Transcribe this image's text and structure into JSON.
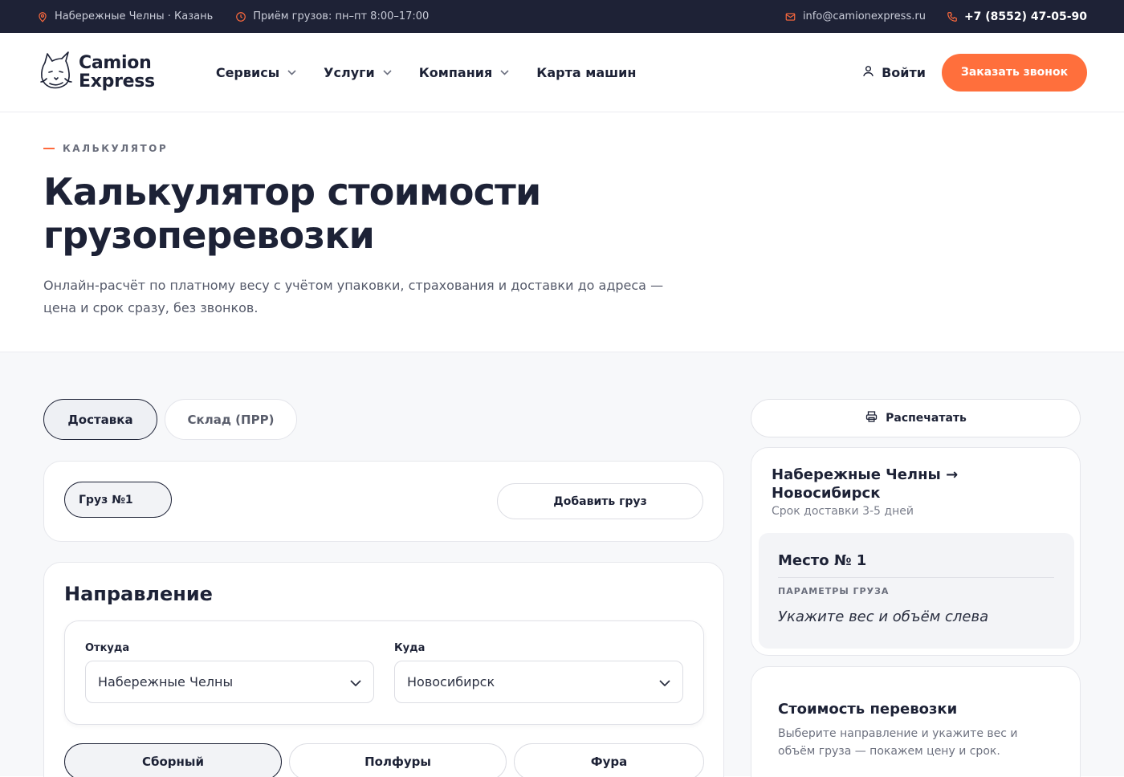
{
  "topbar": {
    "location": "Набережные Челны · Казань",
    "hours": "Приём грузов: пн–пт 8:00–17:00",
    "email": "info@camionexpress.ru",
    "phone": "+7 (8552) 47-05-90"
  },
  "header": {
    "logo_line1": "Camion",
    "logo_line2": "Express",
    "nav": [
      "Сервисы",
      "Услуги",
      "Компания",
      "Карта машин"
    ],
    "login": "Войти",
    "callback": "Заказать звонок"
  },
  "hero": {
    "eyebrow": "КАЛЬКУЛЯТОР",
    "title_line1": "Калькулятор стоимости",
    "title_line2": "грузоперевозки",
    "subtitle_line1": "Онлайн-расчёт по платному весу с учётом упаковки, страхования и доставки до адреса —",
    "subtitle_line2": "цена и срок сразу, без звонков."
  },
  "calculator": {
    "tabs": [
      "Доставка",
      "Склад (ПРР)"
    ],
    "active_tab": "Доставка",
    "cargo_pill": "Груз №1",
    "add_cargo": "Добавить груз",
    "direction": {
      "title": "Направление",
      "from_label": "Откуда",
      "from_value": "Набережные Челны",
      "to_label": "Куда",
      "to_value": "Новосибирск"
    },
    "transport_types": [
      "Сборный",
      "Полфуры",
      "Фура"
    ],
    "active_type": "Сборный"
  },
  "sidebar": {
    "print": "Распечатать",
    "route_title": "Набережные Челны → Новосибирск",
    "route_term": "Срок доставки 3-5 дней",
    "place_title": "Место № 1",
    "place_label": "ПАРАМЕТРЫ ГРУЗА",
    "place_hint": "Укажите вес и объём слева",
    "cost_title": "Стоимость перевозки",
    "cost_desc": "Выберите направление и укажите вес и объём груза — покажем цену и срок."
  },
  "colors": {
    "accent": "#ff6f3c",
    "dark": "#1e2236",
    "page_bg": "#f7f8fa"
  }
}
